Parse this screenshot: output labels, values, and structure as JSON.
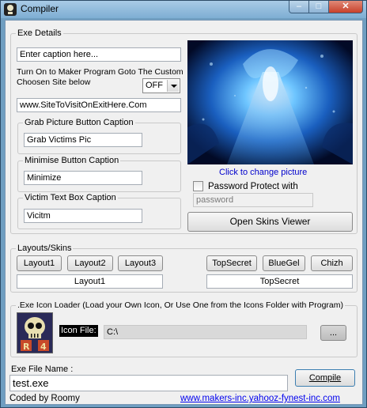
{
  "window": {
    "title": "Compiler",
    "min_glyph": "–",
    "max_glyph": "□",
    "close_glyph": "✕"
  },
  "exe_details": {
    "group_label": "Exe Details",
    "caption_value": "Enter caption here...",
    "turn_on_text_line1": "Turn On to Maker Program Goto The Custom",
    "turn_on_text_line2": "Choosen Site below",
    "onoff_selected": "OFF",
    "site_value": "www.SiteToVisitOnExitHere.Com",
    "grab_group": "Grab Picture Button Caption",
    "grab_value": "Grab Victims Pic",
    "minimise_group": "Minimise Button Caption",
    "minimise_value": "Minimize",
    "victim_group": "Victim Text Box Caption",
    "victim_value": "Vicitm",
    "change_picture": "Click to change picture",
    "password_protect": "Password Protect with",
    "password_placeholder": "password",
    "skins_viewer": "Open Skins Viewer"
  },
  "layouts": {
    "group_label": "Layouts/Skins",
    "layout_buttons": [
      "Layout1",
      "Layout2",
      "Layout3"
    ],
    "skin_buttons": [
      "TopSecret",
      "BlueGel",
      "Chizh"
    ],
    "selected_layout": "Layout1",
    "selected_skin": "TopSecret"
  },
  "icon_loader": {
    "group_label": ".Exe Icon Loader (Load your Own Icon, Or Use One from the Icons Folder with Program)",
    "icon_file_label": "Icon File:",
    "path_value": "C:\\",
    "browse_label": "..."
  },
  "footer": {
    "exe_name_label": "Exe File Name :",
    "exe_name_value": "test.exe",
    "compile_label": "Compile",
    "credit": "Coded by Roomy",
    "url": "www.makers-inc.yahooz-fynest-inc.com"
  },
  "colors": {
    "title_bg": "#8fb8dc",
    "client_bg": "#f0f0f0",
    "link": "#0000ee",
    "close_red": "#c8412b"
  }
}
